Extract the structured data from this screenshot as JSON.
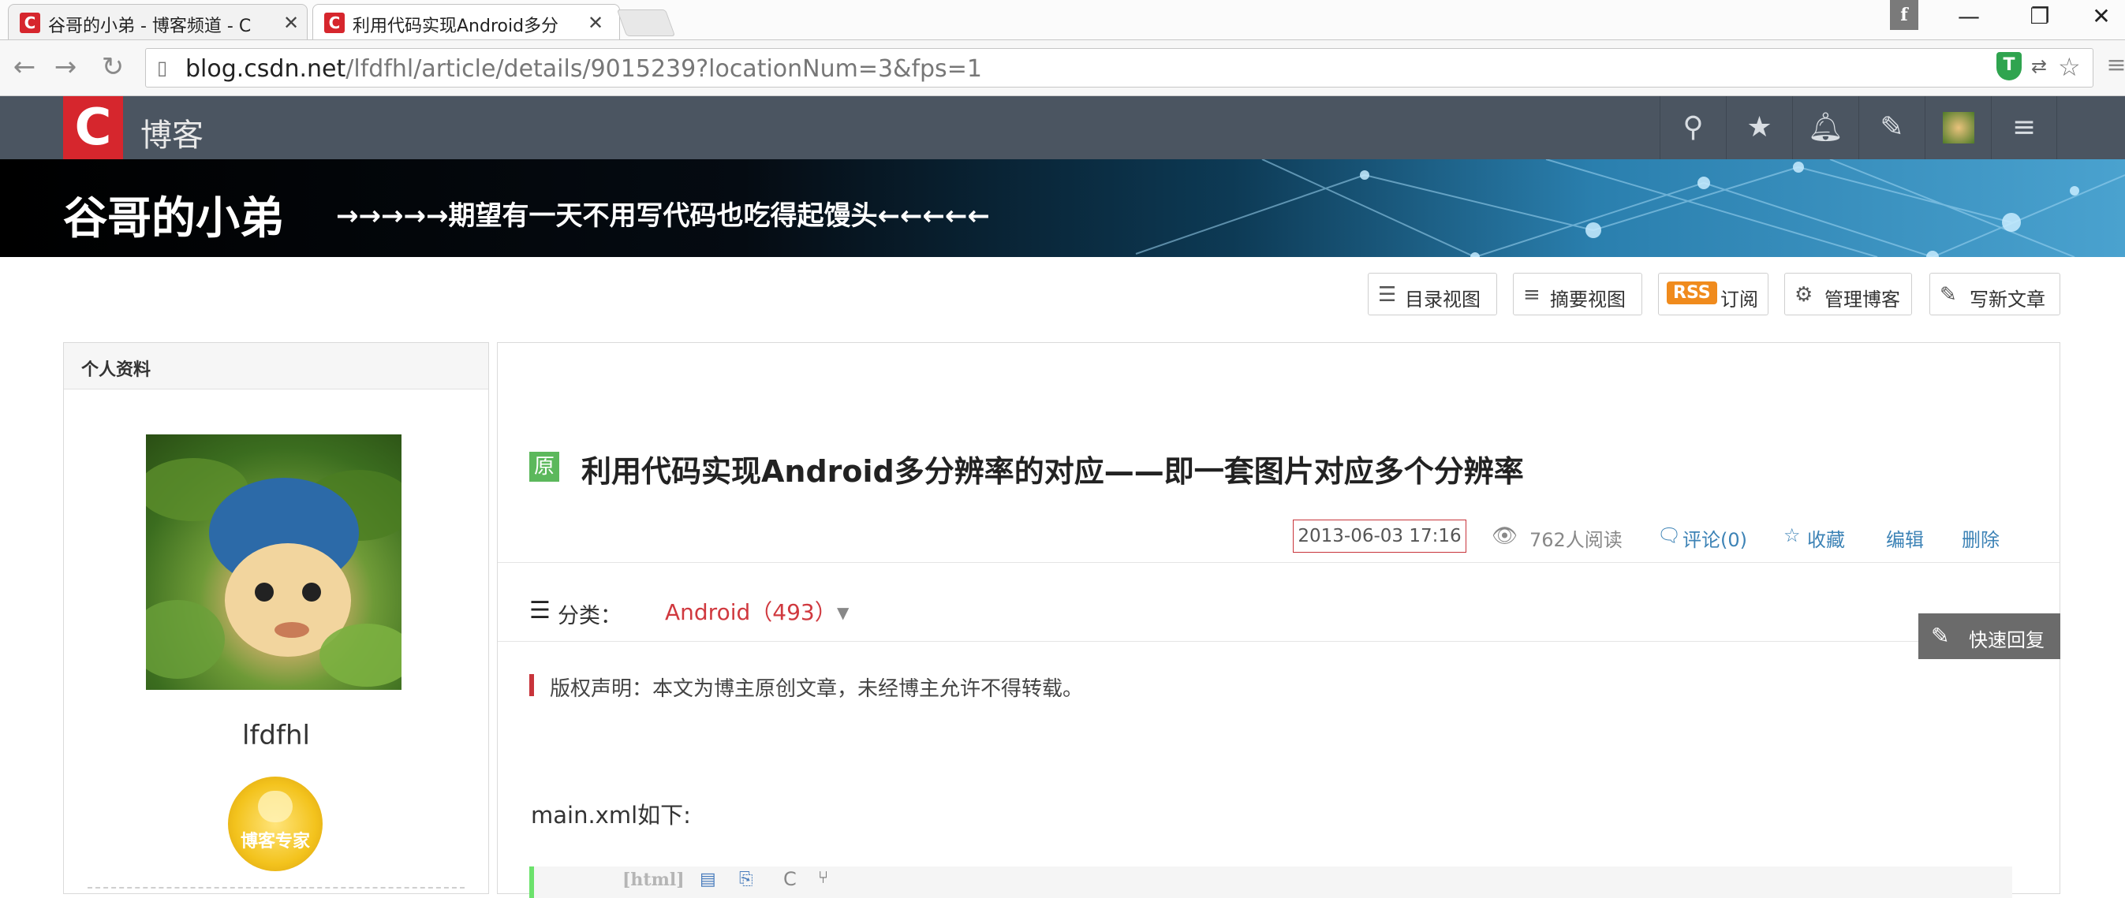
{
  "browser": {
    "tabs": [
      {
        "title": "谷哥的小弟 - 博客频道 - C",
        "active": false
      },
      {
        "title": "利用代码实现Android多分",
        "active": true
      }
    ],
    "profile_glyph": "f",
    "window_controls": {
      "minimize": "—",
      "maximize": "❐",
      "close": "✕"
    },
    "url_host": "blog.csdn.net",
    "url_path": "/lfdfhl/article/details/9015239?locationNum=3&fps=1"
  },
  "toolbar": {
    "logo": "C",
    "label": "博客",
    "icons": [
      "search-icon",
      "star-icon",
      "bell-icon",
      "edit-icon",
      "avatar-icon",
      "menu-icon"
    ]
  },
  "banner": {
    "title": "谷哥的小弟",
    "subtitle": "→→→→→期望有一天不用写代码也吃得起馒头←←←←←"
  },
  "actions": {
    "catalog": "目录视图",
    "summary": "摘要视图",
    "rss_badge": "RSS",
    "subscribe": "订阅",
    "manage": "管理博客",
    "write": "写新文章"
  },
  "sidebar": {
    "title": "个人资料",
    "username": "lfdfhl",
    "badge": "博客专家"
  },
  "article": {
    "original_badge": "原",
    "title": "利用代码实现Android多分辨率的对应——即一套图片对应多个分辨率",
    "date": "2013-06-03 17:16",
    "reads": "762人阅读",
    "comments": "评论(0)",
    "favorite": "收藏",
    "edit": "编辑",
    "delete": "删除",
    "category_label": "分类：",
    "category_value": "Android（493）",
    "copyright": "版权声明：本文为博主原创文章，未经博主允许不得转载。",
    "body_line": "main.xml如下:",
    "code_lang": "[html]"
  },
  "quick_reply": "快速回复",
  "colors": {
    "csdn_red": "#d6262d",
    "toolbar_bg": "#4b5561",
    "link_blue": "#3d83b6",
    "category_red": "#d0393f",
    "original_green": "#5cb85c"
  }
}
